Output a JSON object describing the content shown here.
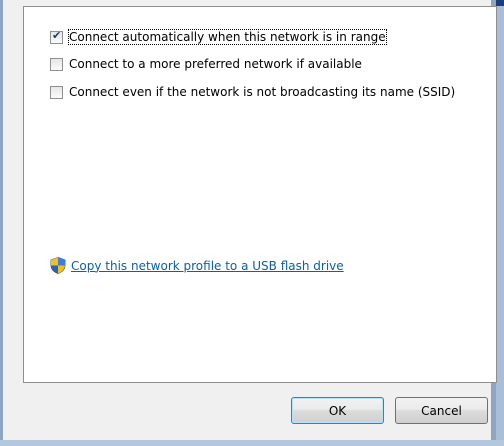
{
  "options": [
    {
      "label": "Connect automatically when this network is in range",
      "checked": true
    },
    {
      "label": "Connect to a more preferred network if available",
      "checked": false
    },
    {
      "label": "Connect even if the network is not broadcasting its name (SSID)",
      "checked": false
    }
  ],
  "link": {
    "icon": "uac-shield-icon",
    "label": "Copy this network profile to a USB flash drive"
  },
  "buttons": {
    "ok": "OK",
    "cancel": "Cancel"
  },
  "colors": {
    "link": "#0b61a4",
    "window_border": "#8fa6c3",
    "title_bar": "#1a3e7a"
  }
}
